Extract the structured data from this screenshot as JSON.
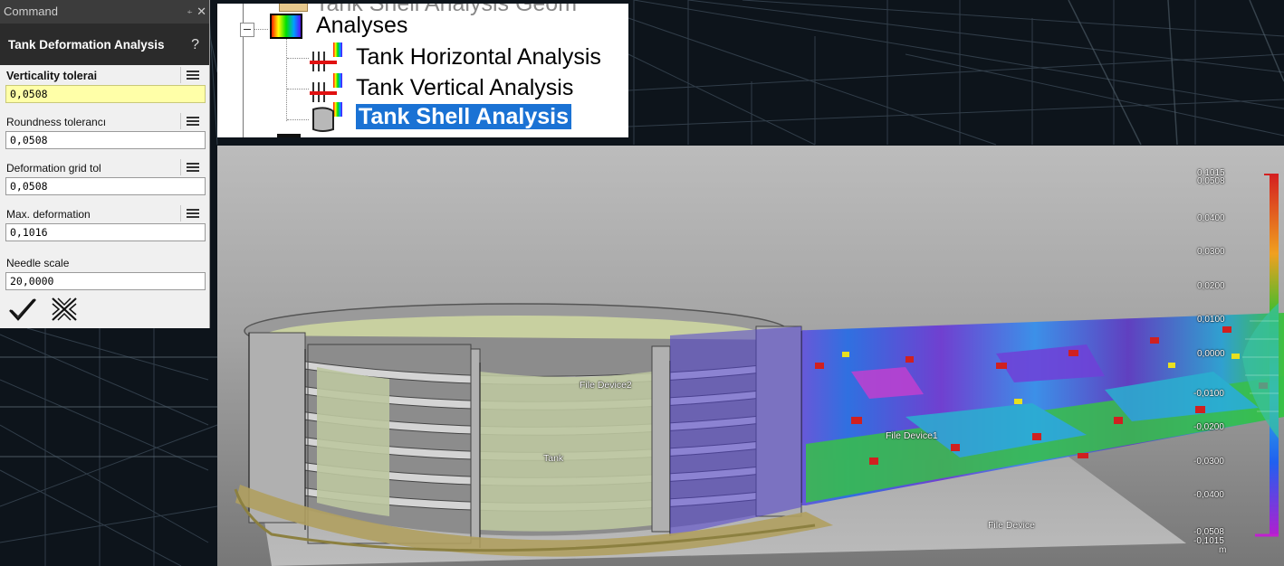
{
  "command_panel": {
    "title": "Command",
    "pin_glyph": "⍅",
    "close_glyph": "✕",
    "header": "Tank Deformation Analysis",
    "help_glyph": "?",
    "fields": [
      {
        "label": "Verticality tolerai",
        "value": "0,0508"
      },
      {
        "label": "Roundness tolerancı",
        "value": "0,0508"
      },
      {
        "label": "Deformation grid tol",
        "value": "0,0508"
      },
      {
        "label": "Max. deformation",
        "value": "0,1016"
      },
      {
        "label": "Needle scale",
        "value": "20,0000"
      }
    ],
    "ok_icon": "checkmark-icon",
    "cancel_icon": "cross-icon"
  },
  "tree": {
    "items": [
      {
        "label": "Tank Shell Analysis Geom"
      },
      {
        "label": "Analyses"
      },
      {
        "label": "Tank Horizontal Analysis"
      },
      {
        "label": "Tank Vertical Analysis"
      },
      {
        "label": "Tank Shell Analysis"
      }
    ],
    "selected_index": 4
  },
  "viewport": {
    "labels": {
      "file_device2": "File Device2",
      "tank": "Tank",
      "file_device1": "File Device1",
      "file_device": "File Device"
    }
  },
  "scale": {
    "labels": [
      "0,1015",
      "0,0508",
      "0,0400",
      "0,0300",
      "0,0200",
      "0,0100",
      "0,0000",
      "-0,0100",
      "-0,0200",
      "-0,0300",
      "-0,0400",
      "-0,0508",
      "-0,1015"
    ],
    "unit": "m",
    "colors": {
      "max": "#d42020",
      "high": "#f0a020",
      "mid": "#30c030",
      "low": "#2060f0",
      "min": "#b020d0"
    }
  }
}
